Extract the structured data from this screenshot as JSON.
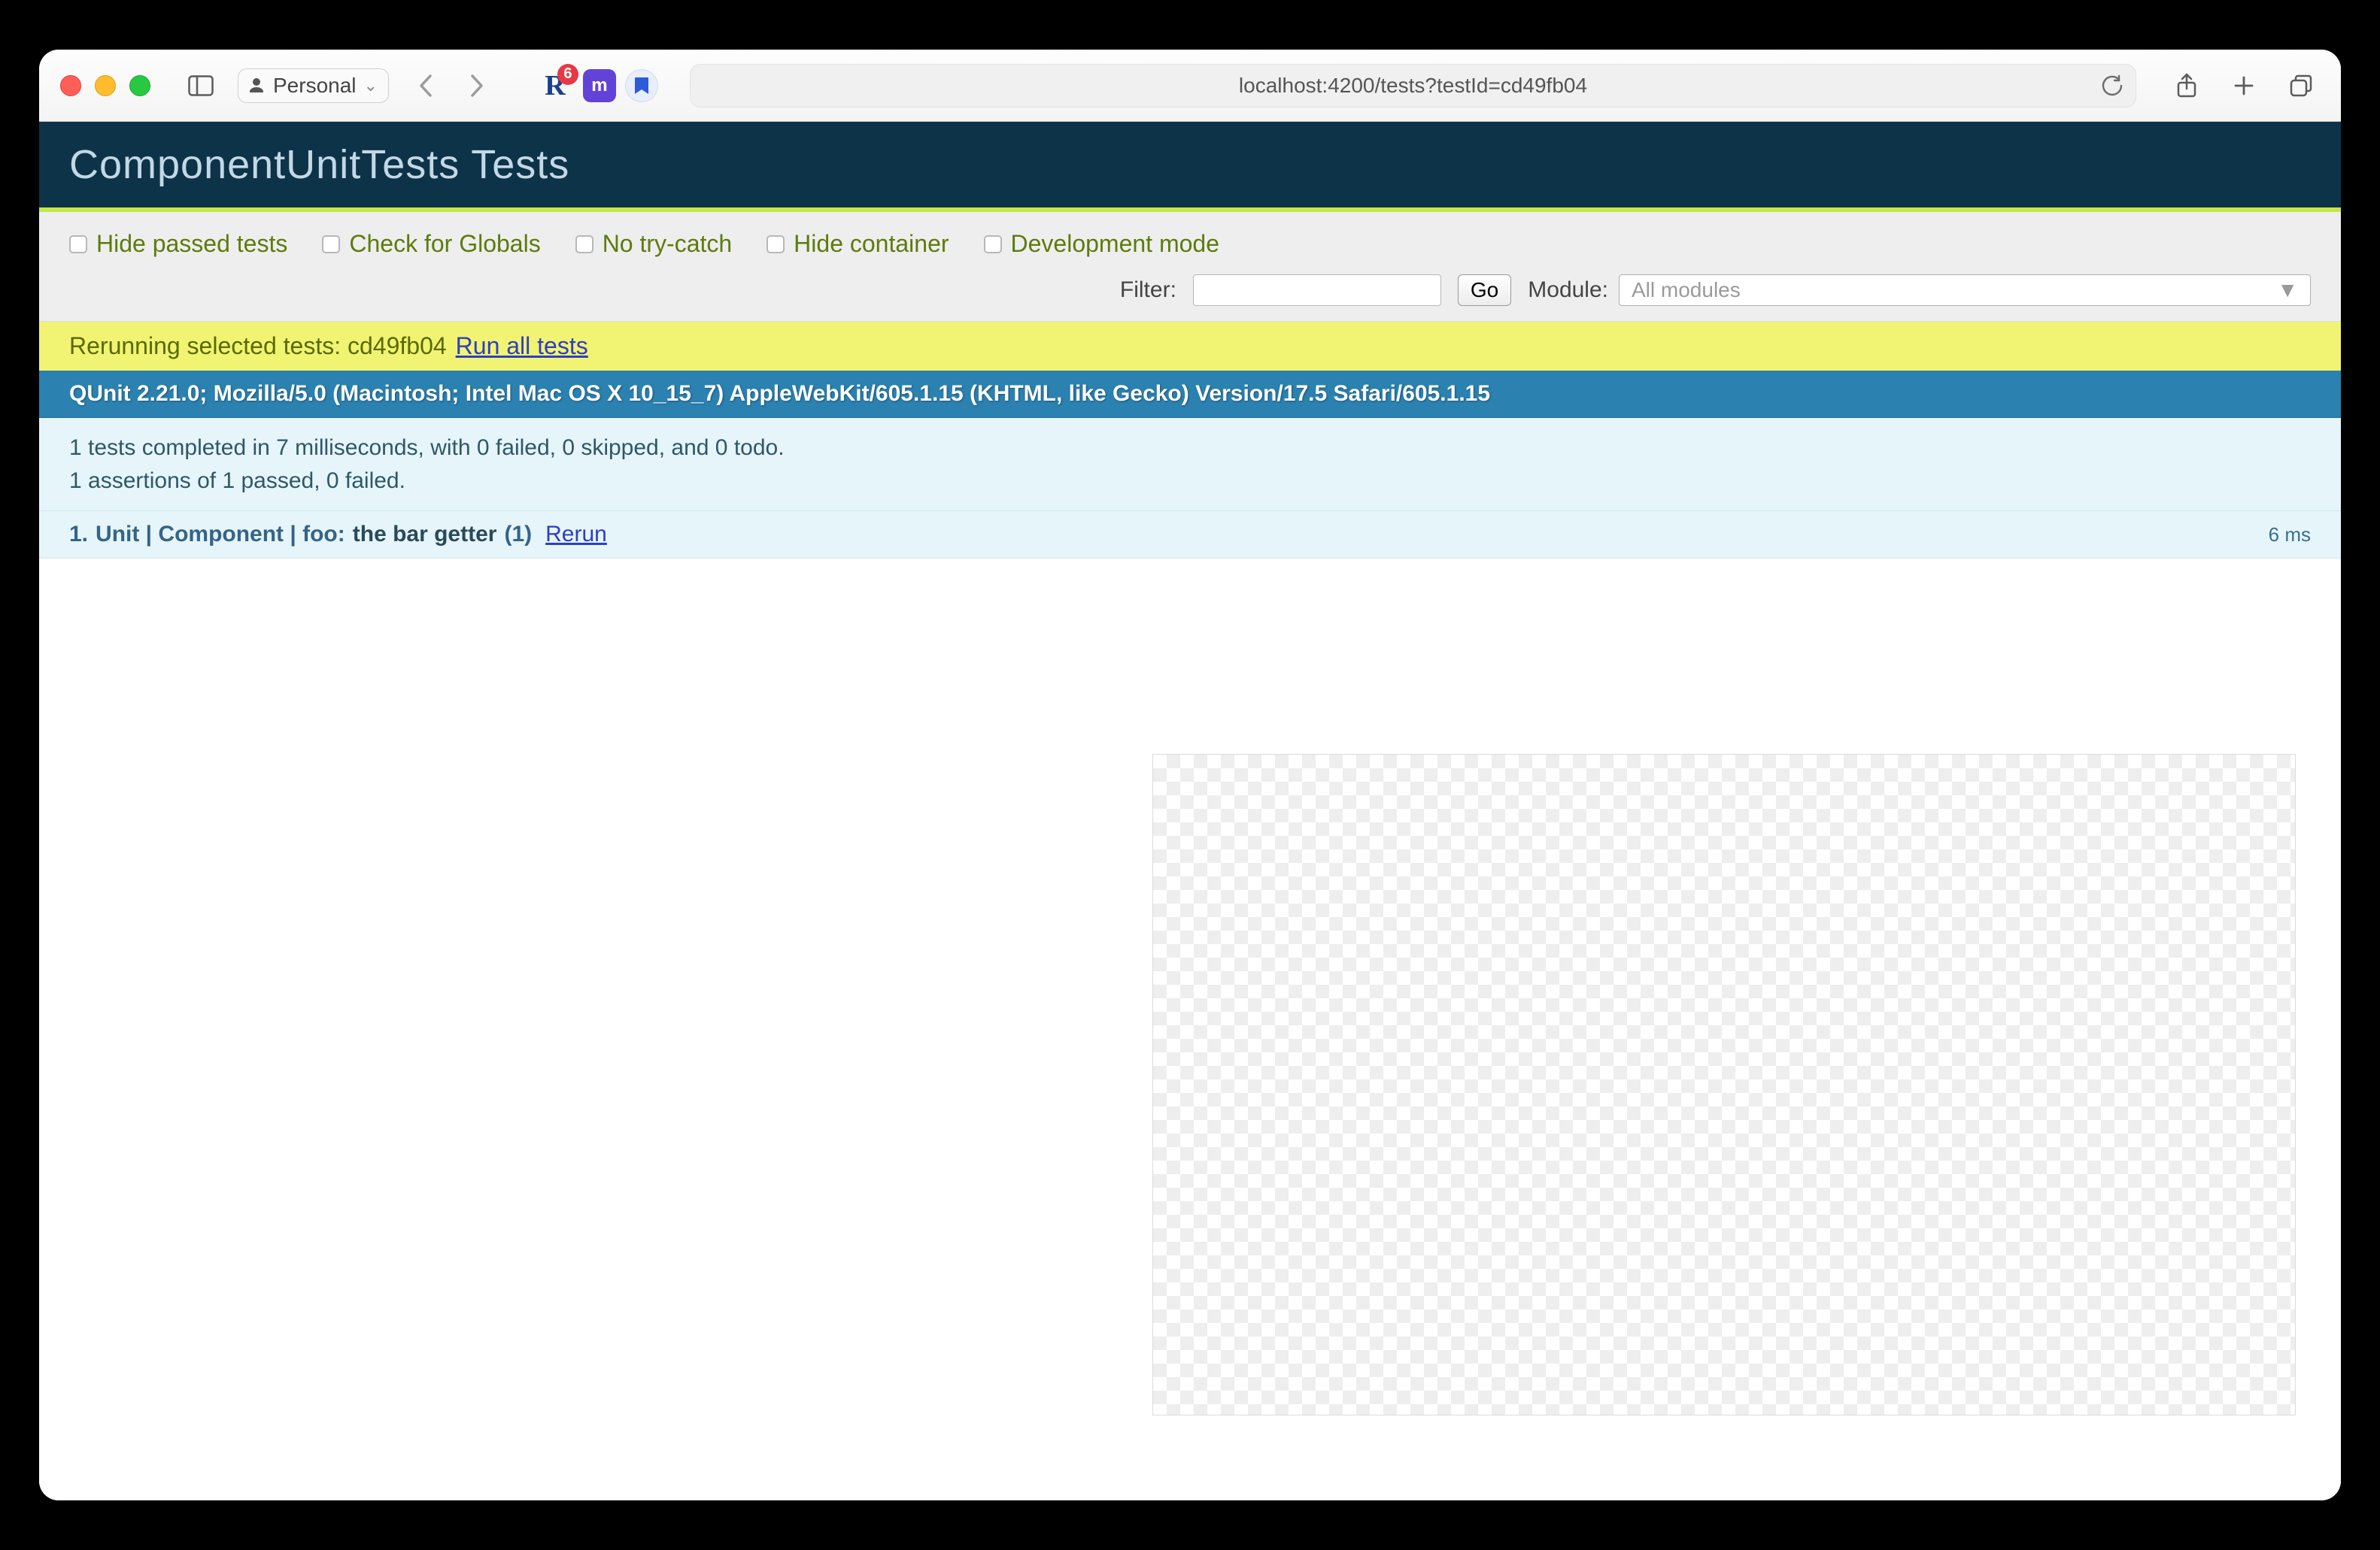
{
  "browser": {
    "profile_label": "Personal",
    "url_display": "localhost:4200/tests?testId=cd49fb04",
    "ext_r_badge": "6",
    "ext_m_letter": "m"
  },
  "qunit": {
    "page_title": "ComponentUnitTests Tests",
    "checks": {
      "hide_passed": "Hide passed tests",
      "check_globals": "Check for Globals",
      "no_trycatch": "No try-catch",
      "hide_container": "Hide container",
      "dev_mode": "Development mode"
    },
    "filter_label": "Filter:",
    "filter_value": "",
    "go_label": "Go",
    "module_label": "Module:",
    "module_placeholder": "All modules",
    "rerun_banner_prefix": "Rerunning selected tests: cd49fb04",
    "rerun_banner_link": "Run all tests",
    "ua_line": "QUnit 2.21.0; Mozilla/5.0 (Macintosh; Intel Mac OS X 10_15_7) AppleWebKit/605.1.15 (KHTML, like Gecko) Version/17.5 Safari/605.1.15",
    "summary_line1": "1 tests completed in 7 milliseconds, with 0 failed, 0 skipped, and 0 todo.",
    "summary_line2": "1 assertions of 1 passed, 0 failed.",
    "test": {
      "index": "1.",
      "module": "Unit | Component | foo:",
      "name": "the bar getter",
      "count": "(1)",
      "rerun": "Rerun",
      "duration": "6 ms"
    }
  }
}
